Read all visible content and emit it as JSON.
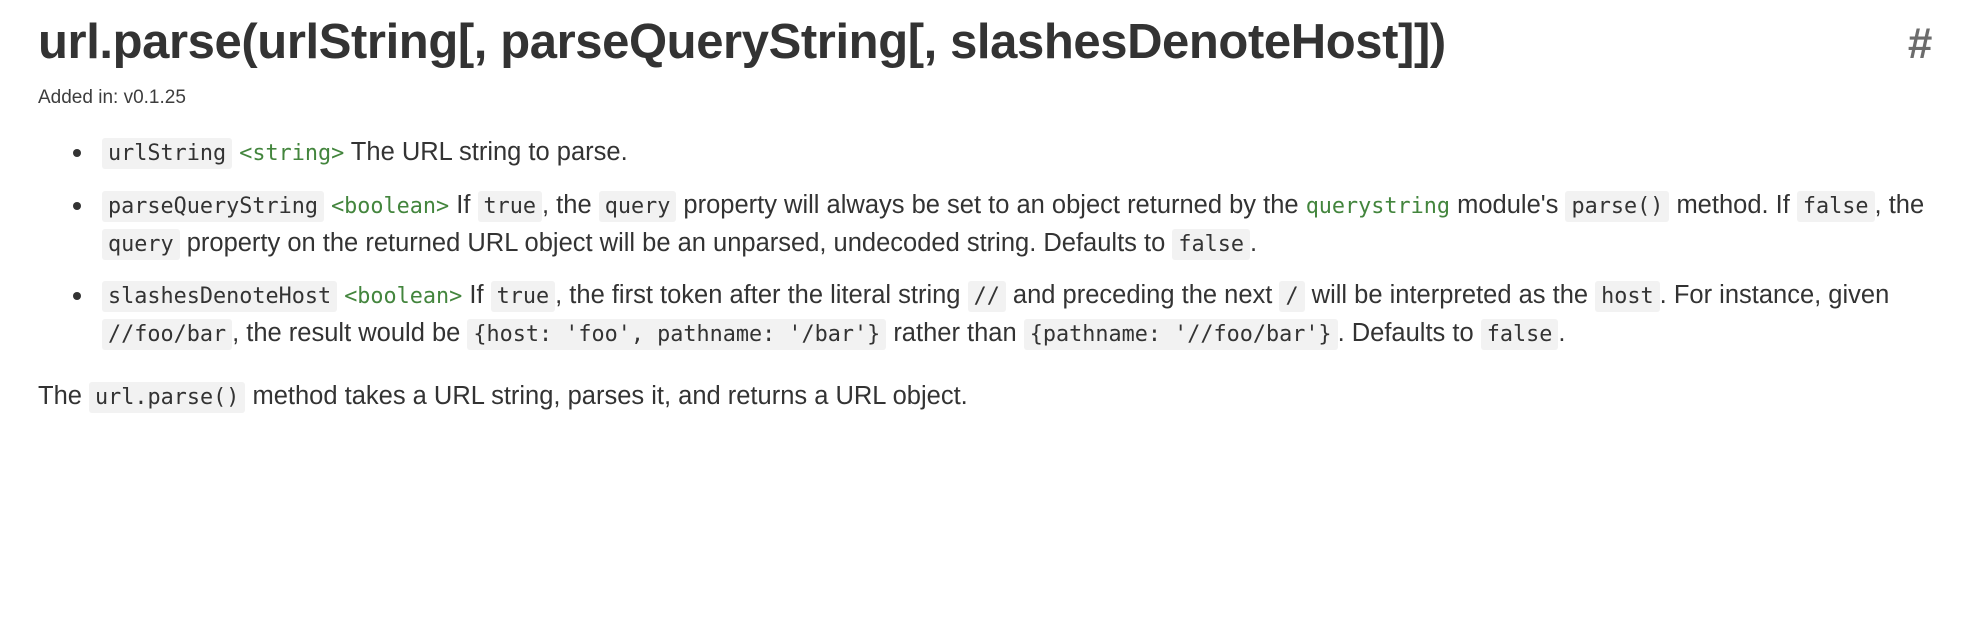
{
  "heading": {
    "title": "url.parse(urlString[, parseQueryString[, slashesDenoteHost]])",
    "anchor": "#"
  },
  "added_in": "Added in: v0.1.25",
  "params": [
    {
      "name": "urlString",
      "type": "<string>",
      "parts": [
        {
          "kind": "text",
          "text": " The URL string to parse."
        }
      ]
    },
    {
      "name": "parseQueryString",
      "type": "<boolean>",
      "parts": [
        {
          "kind": "text",
          "text": " If "
        },
        {
          "kind": "code",
          "text": "true"
        },
        {
          "kind": "text",
          "text": ", the "
        },
        {
          "kind": "code",
          "text": "query"
        },
        {
          "kind": "text",
          "text": " property will always be set to an object returned by the "
        },
        {
          "kind": "link",
          "text": "querystring"
        },
        {
          "kind": "text",
          "text": " module's "
        },
        {
          "kind": "code",
          "text": "parse()"
        },
        {
          "kind": "text",
          "text": " method. If "
        },
        {
          "kind": "code",
          "text": "false"
        },
        {
          "kind": "text",
          "text": ", the "
        },
        {
          "kind": "code",
          "text": "query"
        },
        {
          "kind": "text",
          "text": " property on the returned URL object will be an unparsed, undecoded string. Defaults to "
        },
        {
          "kind": "code",
          "text": "false"
        },
        {
          "kind": "text",
          "text": "."
        }
      ]
    },
    {
      "name": "slashesDenoteHost",
      "type": "<boolean>",
      "parts": [
        {
          "kind": "text",
          "text": " If "
        },
        {
          "kind": "code",
          "text": "true"
        },
        {
          "kind": "text",
          "text": ", the first token after the literal string "
        },
        {
          "kind": "code",
          "text": "//"
        },
        {
          "kind": "text",
          "text": " and preceding the next "
        },
        {
          "kind": "code",
          "text": "/"
        },
        {
          "kind": "text",
          "text": " will be interpreted as the "
        },
        {
          "kind": "code",
          "text": "host"
        },
        {
          "kind": "text",
          "text": ". For instance, given "
        },
        {
          "kind": "code",
          "text": "//foo/bar"
        },
        {
          "kind": "text",
          "text": ", the result would be "
        },
        {
          "kind": "code",
          "text": "{host: 'foo', pathname: '/bar'}"
        },
        {
          "kind": "text",
          "text": " rather than "
        },
        {
          "kind": "code",
          "text": "{pathname: '//foo/bar'}"
        },
        {
          "kind": "text",
          "text": ". Defaults to "
        },
        {
          "kind": "code",
          "text": "false"
        },
        {
          "kind": "text",
          "text": "."
        }
      ]
    }
  ],
  "description": {
    "parts": [
      {
        "kind": "text",
        "text": "The "
      },
      {
        "kind": "code",
        "text": "url.parse()"
      },
      {
        "kind": "text",
        "text": " method takes a URL string, parses it, and returns a URL object."
      }
    ]
  },
  "colors": {
    "link_green": "#43853d",
    "code_background": "#f2f2f2",
    "text": "#333333",
    "anchor_gray": "#6c6c6c"
  }
}
